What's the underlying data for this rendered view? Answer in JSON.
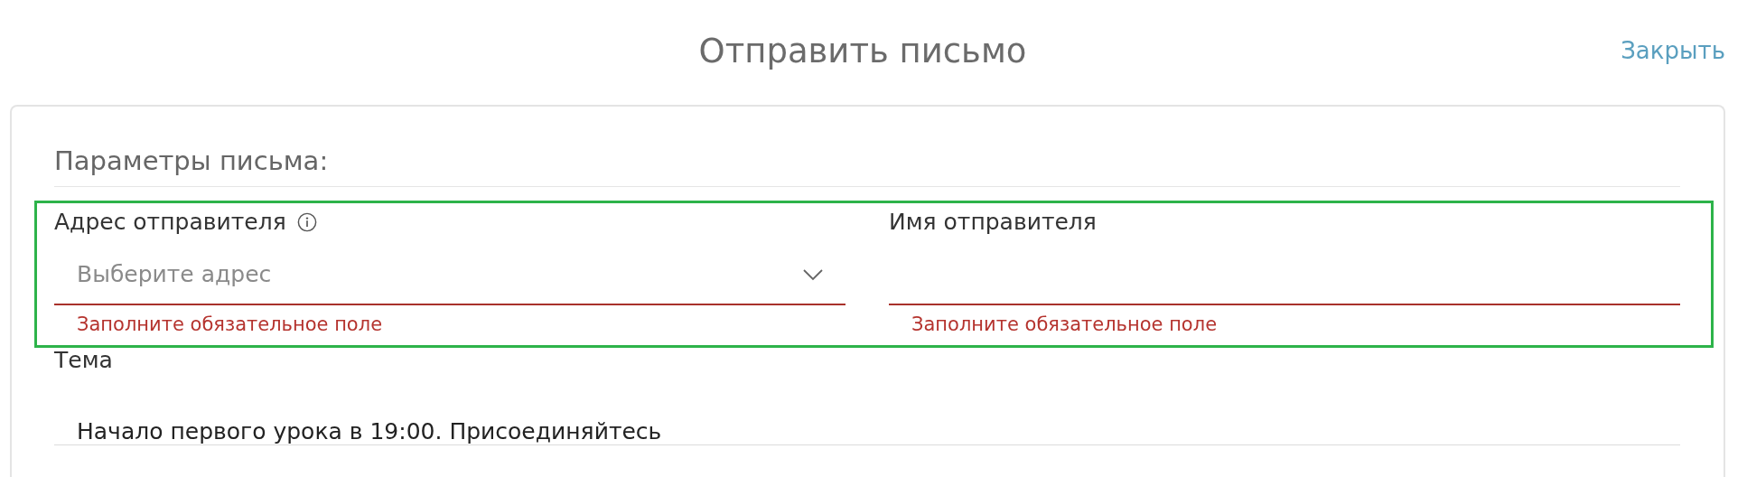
{
  "dialog": {
    "title": "Отправить письмо",
    "close_link": "Закрыть"
  },
  "section": {
    "heading": "Параметры письма:"
  },
  "rows": [
    {
      "highlighted": true,
      "fields": [
        {
          "kind": "select",
          "label": "Адрес отправителя",
          "info": true,
          "placeholder": "Выберите адрес",
          "error": "Заполните обязательное поле"
        },
        {
          "kind": "text",
          "label": "Имя отправителя",
          "info": false,
          "error": "Заполните обязательное поле"
        }
      ]
    },
    {
      "highlighted": false,
      "fields": [
        {
          "kind": "text",
          "label": "Тема",
          "info": false,
          "value": "Начало первого урока в 19:00. Присоединяйтесь"
        }
      ]
    }
  ]
}
